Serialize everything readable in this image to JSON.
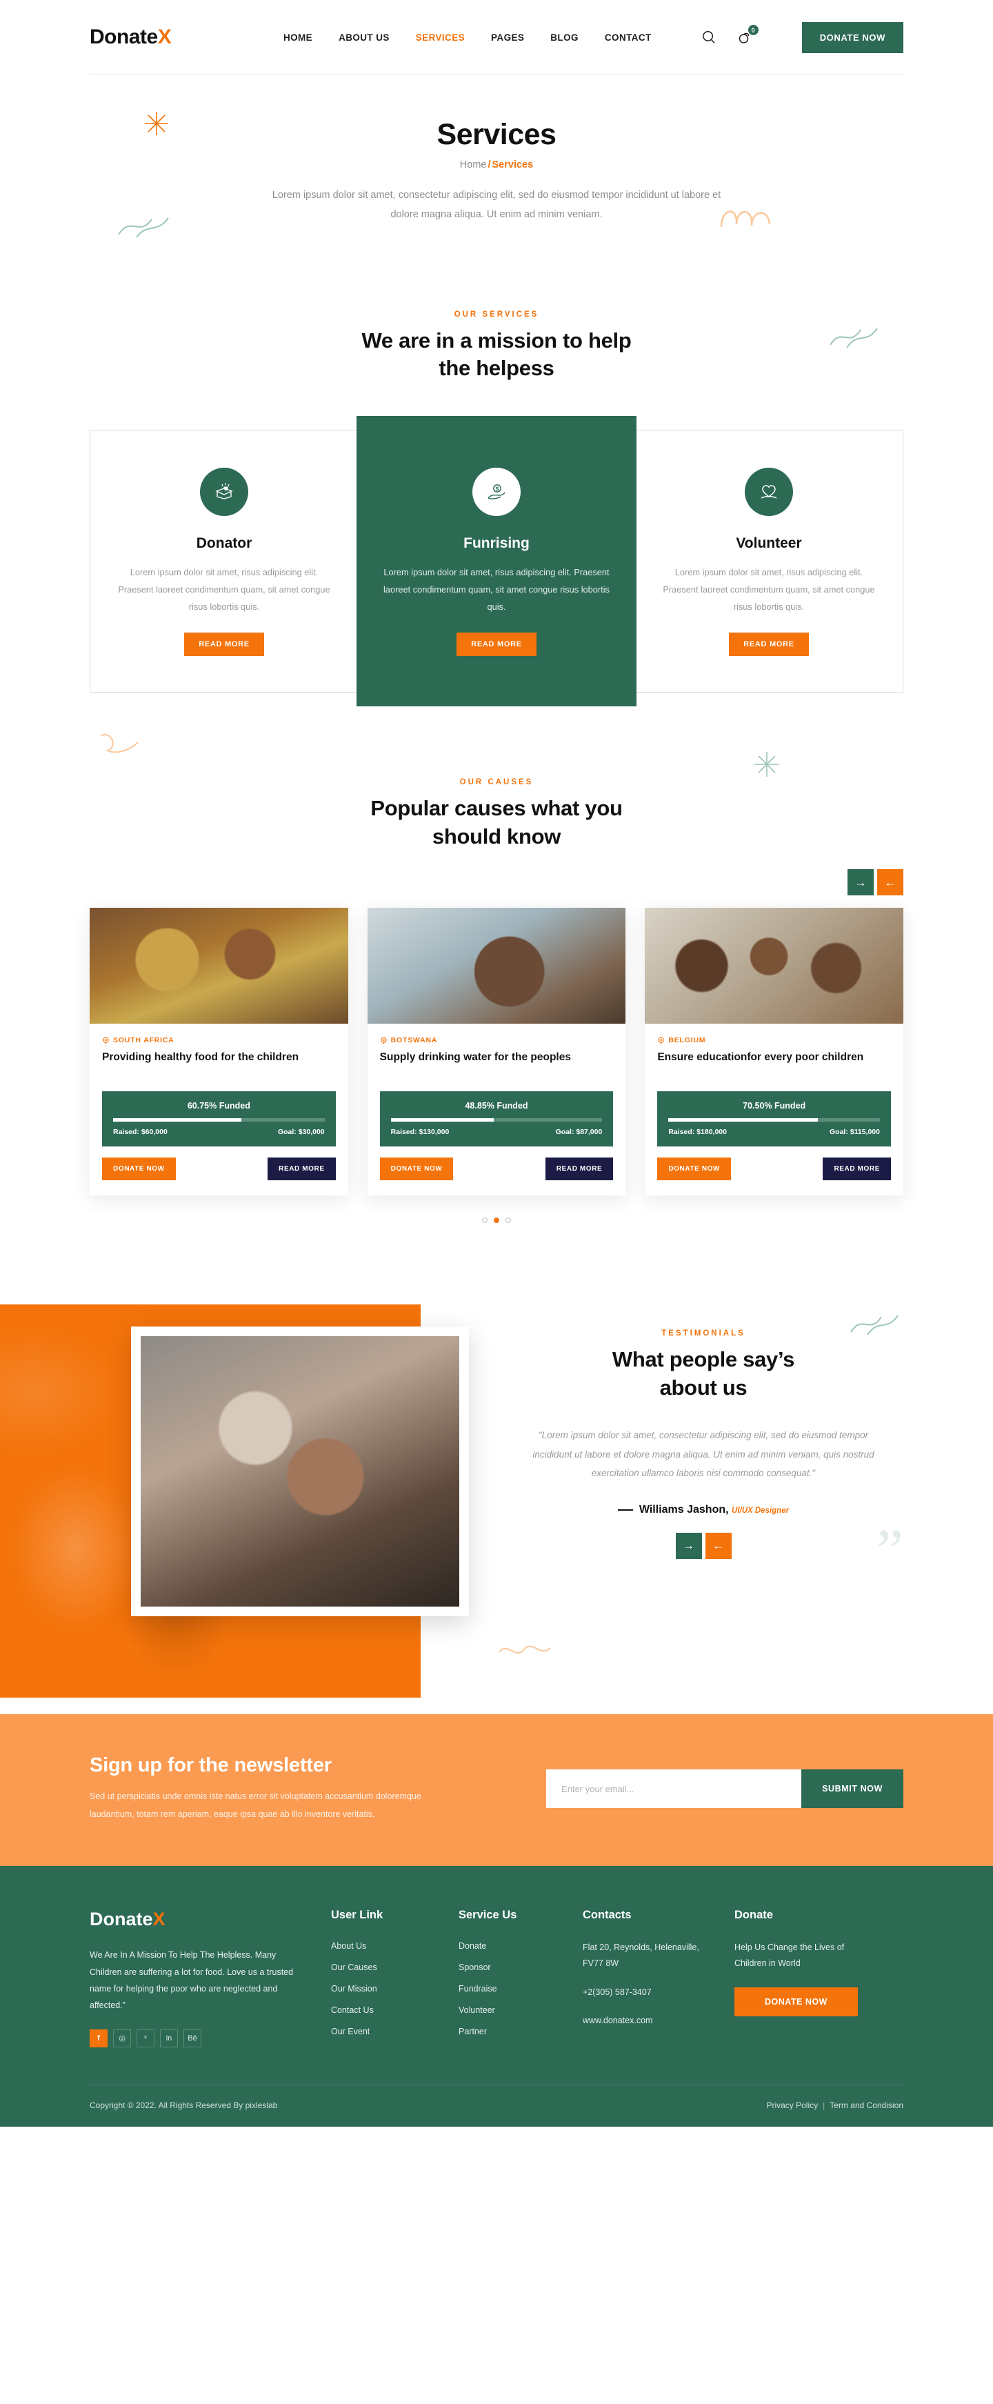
{
  "header": {
    "logo_main": "Donate",
    "logo_accent": "X",
    "nav": [
      {
        "label": "HOME",
        "active": false
      },
      {
        "label": "ABOUT US",
        "active": false
      },
      {
        "label": "SERVICES",
        "active": true
      },
      {
        "label": "PAGES",
        "active": false
      },
      {
        "label": "BLOG",
        "active": false
      },
      {
        "label": "CONTACT",
        "active": false
      }
    ],
    "search_icon": "search-icon",
    "cart_icon": "cart-icon",
    "cart_count": "0",
    "donate_label": "DONATE NOW"
  },
  "hero": {
    "title": "Services",
    "breadcrumb_home": "Home",
    "breadcrumb_sep": "/",
    "breadcrumb_current": "Services",
    "description": "Lorem ipsum dolor sit amet, consectetur adipiscing elit, sed do eiusmod tempor incididunt ut labore et dolore magna aliqua. Ut enim ad minim veniam."
  },
  "services": {
    "label": "OUR SERVICES",
    "title_line1": "We are in a mission to help",
    "title_line2": "the helpess",
    "cards": [
      {
        "icon": "gift-box-heart-icon",
        "title": "Donator",
        "text": "Lorem ipsum dolor sit amet, risus adipiscing elit. Praesent laoreet condimentum quam, sit amet congue risus lobortis quis.",
        "button": "READ MORE",
        "featured": false
      },
      {
        "icon": "hand-holding-dollar-icon",
        "title": "Funrising",
        "text": "Lorem ipsum dolor sit amet, risus adipiscing elit. Praesent laoreet condimentum quam, sit amet congue risus lobortis quis.",
        "button": "READ MORE",
        "featured": true
      },
      {
        "icon": "hand-heart-icon",
        "title": "Volunteer",
        "text": "Lorem ipsum dolor sit amet, risus adipiscing elit. Praesent laoreet condimentum quam, sit amet congue risus lobortis quis.",
        "button": "READ MORE",
        "featured": false
      }
    ]
  },
  "causes": {
    "label": "OUR CAUSES",
    "title_line1": "Popular causes what you",
    "title_line2": "should know",
    "next_arrow": "→",
    "prev_arrow": "←",
    "cards": [
      {
        "location": "SOUTH AFRICA",
        "title": "Providing healthy food for the children",
        "funded": "60.75% Funded",
        "progress": 60.75,
        "raised": "Raised: $60,000",
        "goal": "Goal: $30,000",
        "donate": "DONATE NOW",
        "read": "READ MORE"
      },
      {
        "location": "BOTSWANA",
        "title": "Supply drinking water for the peoples",
        "funded": "48.85% Funded",
        "progress": 48.85,
        "raised": "Raised: $130,000",
        "goal": "Goal: $87,000",
        "donate": "DONATE NOW",
        "read": "READ MORE"
      },
      {
        "location": "BELGIUM",
        "title": "Ensure educationfor every poor children",
        "funded": "70.50% Funded",
        "progress": 70.5,
        "raised": "Raised: $180,000",
        "goal": "Goal: $115,000",
        "donate": "DONATE NOW",
        "read": "READ MORE"
      }
    ],
    "dots": [
      false,
      true,
      false
    ]
  },
  "testimonials": {
    "label": "TESTIMONIALS",
    "title_line1": "What people say’s",
    "title_line2": "about us",
    "quote": "\"Lorem ipsum dolor sit amet, consectetur adipiscing elit, sed do eiusmod tempor incididunt ut labore et dolore magna aliqua. Ut enim ad minim veniam, quis nostrud exercitation ullamco laboris nisi commodo consequat.\"",
    "author": "Williams Jashon,",
    "role": "UI/UX Designer",
    "next_arrow": "→",
    "prev_arrow": "←",
    "quote_mark": "”"
  },
  "newsletter": {
    "title": "Sign up for the newsletter",
    "text": "Sed ut perspiciatis unde omnis iste natus error sit voluptatem accusantium doloremque laudantium, totam rem aperiam, eaque ipsa quae ab illo inventore veritatis.",
    "placeholder": "Enter your email...",
    "submit": "SUBMIT NOW"
  },
  "footer": {
    "logo_main": "Donate",
    "logo_accent": "X",
    "about": "We Are In A Mission To Help The Helpless. Many Children are suffering a lot for food. Love us a trusted name for helping the poor who are neglected and affected.”",
    "social": [
      {
        "name": "facebook-icon",
        "glyph": "f"
      },
      {
        "name": "instagram-icon",
        "glyph": "◎"
      },
      {
        "name": "twitter-icon",
        "glyph": "ᵛ"
      },
      {
        "name": "linkedin-icon",
        "glyph": "in"
      },
      {
        "name": "behance-icon",
        "glyph": "Bē"
      }
    ],
    "col_user": {
      "title": "User Link",
      "items": [
        "About Us",
        "Our Causes",
        "Our Mission",
        "Contact Us",
        "Our Event"
      ]
    },
    "col_service": {
      "title": "Service Us",
      "items": [
        "Donate",
        "Sponsor",
        "Fundraise",
        "Volunteer",
        "Partner"
      ]
    },
    "col_contacts": {
      "title": "Contacts",
      "address": "Flat 20, Reynolds, Helenaville, FV77 8W",
      "phone": "+2(305) 587-3407",
      "site": "www.donatex.com"
    },
    "col_donate": {
      "title": "Donate",
      "text": "Help Us Change the Lives of Children in World",
      "button": "DONATE NOW"
    },
    "copyright": "Copyright © 2022. All Rights Reserved By pixleslab",
    "privacy": "Privacy Policy",
    "bar": "|",
    "terms": "Term and Condision"
  },
  "colors": {
    "green": "#2d6a54",
    "orange": "#f4730b",
    "orange_light": "#fb9b52",
    "navy": "#1b1b45"
  }
}
